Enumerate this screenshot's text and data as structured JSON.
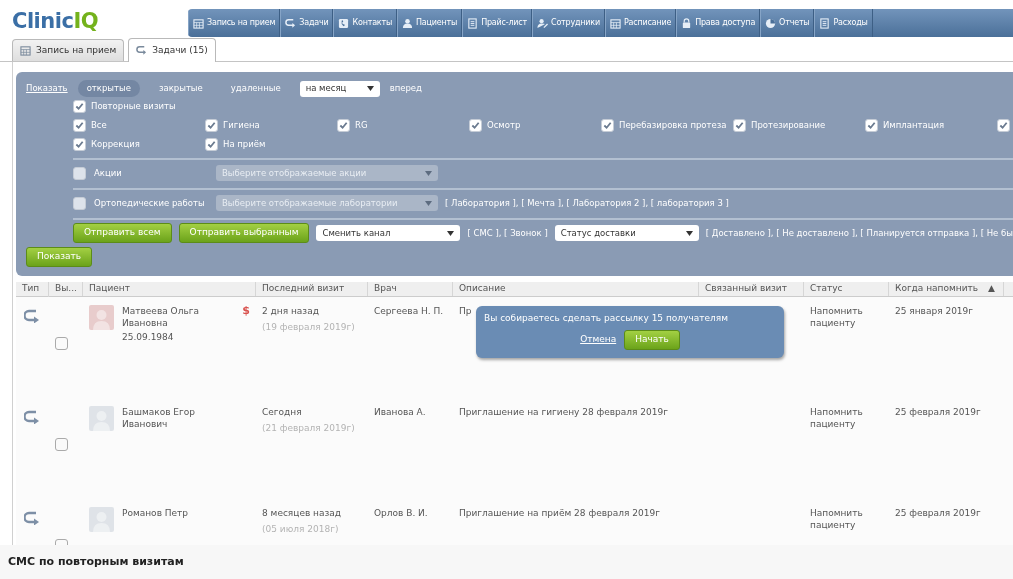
{
  "logo": {
    "name": "Clinic",
    "suffix": "IQ"
  },
  "nav": [
    {
      "label": "Запись на прием",
      "kind": "calendar"
    },
    {
      "label": "Задачи",
      "kind": "loop"
    },
    {
      "label": "Контакты",
      "kind": "phone"
    },
    {
      "label": "Пациенты",
      "kind": "person"
    },
    {
      "label": "Прайс-лист",
      "kind": "list"
    },
    {
      "label": "Сотрудники",
      "kind": "edit"
    },
    {
      "label": "Расписание",
      "kind": "calendar"
    },
    {
      "label": "Права доступа",
      "kind": "lock"
    },
    {
      "label": "Отчеты",
      "kind": "pie"
    },
    {
      "label": "Расходы",
      "kind": "list"
    }
  ],
  "tabs": [
    {
      "label": "Запись на прием",
      "kind": "calendar",
      "selected": false
    },
    {
      "label": "Задачи (15)",
      "kind": "loop",
      "selected": true
    }
  ],
  "filter": {
    "show_link": "Показать",
    "states": [
      {
        "label": "открытые",
        "selected": true
      },
      {
        "label": "закрытые",
        "selected": false
      },
      {
        "label": "удаленные",
        "selected": false
      }
    ],
    "period": {
      "value": "на месяц"
    },
    "direction": "вперед",
    "repeat_visits": {
      "label": "Повторные визиты",
      "checked": true
    },
    "visit_types": [
      {
        "label": "Все",
        "checked": true
      },
      {
        "label": "Гигиена",
        "checked": true
      },
      {
        "label": "RG",
        "checked": true
      },
      {
        "label": "Осмотр",
        "checked": true
      },
      {
        "label": "Перебазировка протеза",
        "checked": true
      },
      {
        "label": "Протезирование",
        "checked": true
      },
      {
        "label": "Имплантация",
        "checked": true
      },
      {
        "checked": true
      },
      {
        "label": "Коррекция",
        "checked": true
      },
      {
        "label": "На приём",
        "checked": true
      }
    ],
    "promotions": {
      "label": "Акции",
      "checked": false,
      "placeholder": "Выберите отображаемые акции"
    },
    "ortho": {
      "label": "Ортопедические работы",
      "checked": false,
      "placeholder": "Выберите отображаемые лаборатории",
      "links": "[ Лаборатория ], [ Мечта ], [ Лаборатория 2 ], [ лаборатория 3 ]"
    },
    "send_all": "Отправить всем",
    "send_selected": "Отправить выбранным",
    "channel": {
      "value": "Сменить канал"
    },
    "channel_links": "[ СМС ], [ Звонок ]",
    "delivery": {
      "value": "Статус доставки"
    },
    "delivery_links": "[ Доставлено ], [ Не доставлено ], [ Планируется отправка ], [ Не бы",
    "apply_button": "Показать"
  },
  "table": {
    "columns": [
      {
        "label": "Тип"
      },
      {
        "label": "Вы..."
      },
      {
        "label": "Пациент"
      },
      {
        "label": "Последний визит"
      },
      {
        "label": "Врач"
      },
      {
        "label": "Описание"
      },
      {
        "label": "Связанный визит"
      },
      {
        "label": "Статус"
      },
      {
        "label": "Когда напомнить",
        "sort_mark": "▲"
      }
    ],
    "rows": [
      {
        "selected": false,
        "avatar": {
          "color": "#e8cccc"
        },
        "name": "Матвеева Ольга Ивановна",
        "birth_date": "25.09.1984",
        "debt_mark": "$",
        "last_visit": "2 дня назад",
        "last_visit_date": "(19 февраля 2019г)",
        "doctor": "Сергеева Н. П.",
        "description": "Пр",
        "status": "Напомнить пациенту",
        "remind": "25 января 2019г"
      },
      {
        "selected": false,
        "avatar": {
          "color": "#dfe3e8"
        },
        "name": "Башмаков Егор Иванович",
        "last_visit": "Сегодня",
        "last_visit_date": "(21 февраля 2019г)",
        "doctor": "Иванова А.",
        "description": "Приглашение на гигиену 28 февраля 2019г",
        "status": "Напомнить пациенту",
        "remind": "25 февраля 2019г"
      },
      {
        "selected": false,
        "avatar": {
          "color": "#dfe3e8"
        },
        "name": "Романов Петр",
        "last_visit": "8 месяцев назад",
        "last_visit_date": "(05 июля 2018г)",
        "doctor": "Орлов В. И.",
        "description": "Приглашение на приём 28 февраля 2019г",
        "status": "Напомнить пациенту",
        "remind": "25 февраля 2019г"
      }
    ]
  },
  "popup": {
    "message": "Вы собираетесь сделать рассылку 15 получателям",
    "cancel": "Отмена",
    "confirm": "Начать"
  },
  "caption": "СМС по повторным визитам"
}
